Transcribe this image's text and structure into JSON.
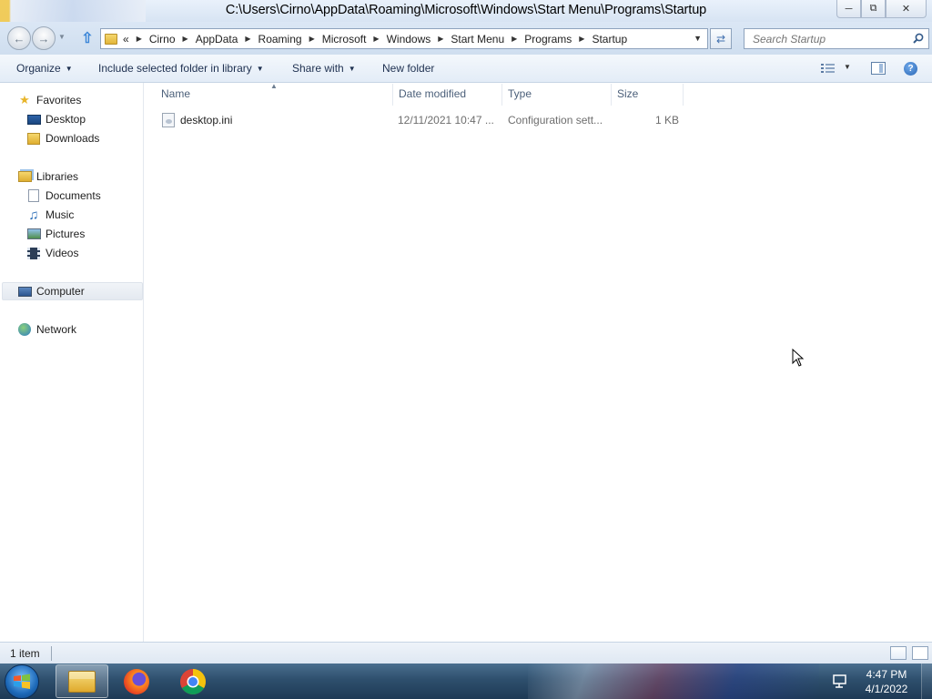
{
  "window": {
    "title": "C:\\Users\\Cirno\\AppData\\Roaming\\Microsoft\\Windows\\Start Menu\\Programs\\Startup",
    "controls": {
      "minimize": "minimize-icon",
      "restore": "restore-icon",
      "close": "close-icon"
    }
  },
  "address": {
    "overflow": "«",
    "breadcrumbs": [
      "Cirno",
      "AppData",
      "Roaming",
      "Microsoft",
      "Windows",
      "Start Menu",
      "Programs",
      "Startup"
    ]
  },
  "search": {
    "placeholder": "Search Startup"
  },
  "toolbar": {
    "organize": "Organize",
    "include_in_library": "Include selected folder in library",
    "share_with": "Share with",
    "new_folder": "New folder"
  },
  "navpane": {
    "favorites": {
      "label": "Favorites",
      "items": [
        "Desktop",
        "Downloads"
      ]
    },
    "libraries": {
      "label": "Libraries",
      "items": [
        "Documents",
        "Music",
        "Pictures",
        "Videos"
      ]
    },
    "computer": "Computer",
    "network": "Network"
  },
  "columns": [
    "Name",
    "Date modified",
    "Type",
    "Size"
  ],
  "files": [
    {
      "name": "desktop.ini",
      "date_modified": "12/11/2021 10:47 ...",
      "type": "Configuration sett...",
      "size": "1 KB"
    }
  ],
  "status": {
    "item_count": "1 item"
  },
  "taskbar": {
    "apps": [
      "windows-explorer-icon",
      "firefox-icon",
      "chrome-icon"
    ],
    "clock": {
      "time": "4:47 PM",
      "date": "4/1/2022"
    }
  },
  "colors": {
    "accent": "#3b86d8",
    "taskbar": "#2e4f6d",
    "header_text": "#4c607a"
  }
}
